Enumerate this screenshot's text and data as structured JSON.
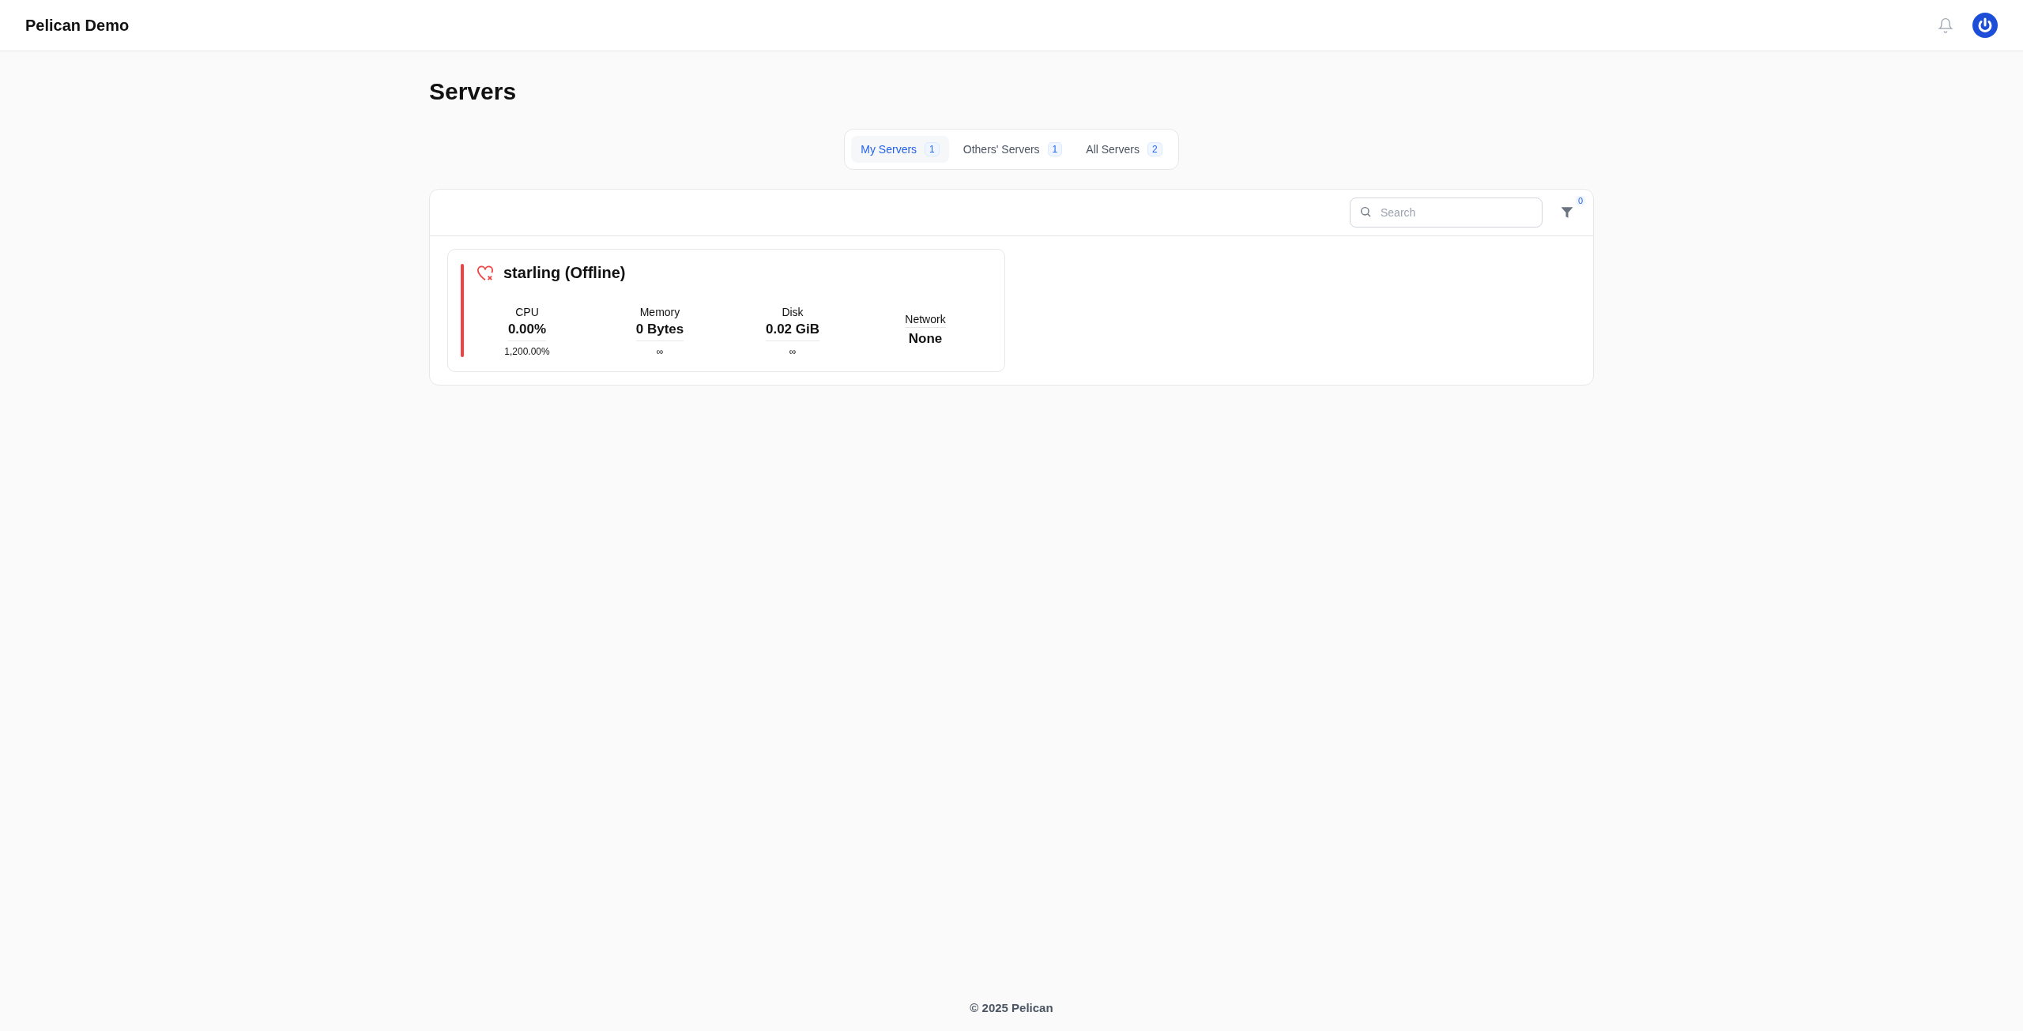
{
  "app": {
    "title": "Pelican Demo"
  },
  "page": {
    "title": "Servers"
  },
  "tabs": [
    {
      "label": "My Servers",
      "count": "1",
      "selected": true
    },
    {
      "label": "Others' Servers",
      "count": "1",
      "selected": false
    },
    {
      "label": "All Servers",
      "count": "2",
      "selected": false
    }
  ],
  "search": {
    "placeholder": "Search"
  },
  "filter": {
    "count": "0"
  },
  "servers": [
    {
      "name": "starling (Offline)",
      "color": "#ef4444",
      "stats": [
        {
          "label": "CPU",
          "value": "0.00%",
          "limit": "1,200.00%"
        },
        {
          "label": "Memory",
          "value": "0 Bytes",
          "limit": "∞"
        },
        {
          "label": "Disk",
          "value": "0.02 GiB",
          "limit": "∞"
        },
        {
          "label": "Network",
          "value": "None"
        }
      ]
    }
  ],
  "footer": {
    "text": "© 2025 Pelican"
  }
}
